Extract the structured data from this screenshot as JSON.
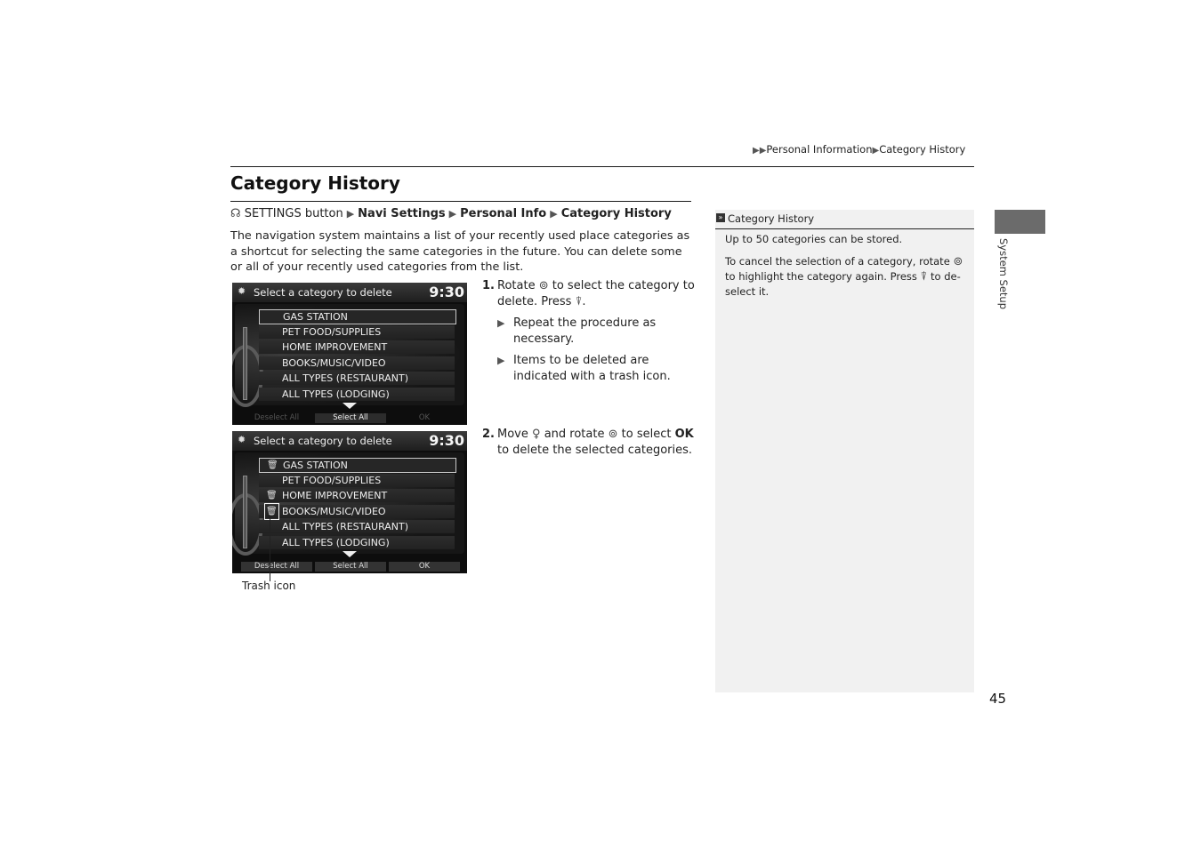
{
  "running_header": {
    "prefix_icon": "double-triangle-icon",
    "section": "Personal Information",
    "separator_icon": "triangle-icon",
    "current": "Category History"
  },
  "title": "Category History",
  "menu_path": {
    "icon": "settings-button-icon",
    "start": "SETTINGS button",
    "items": [
      "Navi Settings",
      "Personal Info",
      "Category History"
    ]
  },
  "intro": "The navigation system maintains a list of your recently used place categories as a shortcut for selecting the same categories in the future. You can delete some or all of your recently used categories from the list.",
  "screens": [
    {
      "title": "Select a category to delete",
      "clock": "9:30",
      "rows": [
        {
          "label": "GAS STATION",
          "selected": true,
          "trash": false
        },
        {
          "label": "PET FOOD/SUPPLIES",
          "selected": false,
          "trash": false
        },
        {
          "label": "HOME IMPROVEMENT",
          "selected": false,
          "trash": false
        },
        {
          "label": "BOOKS/MUSIC/VIDEO",
          "selected": false,
          "trash": false
        },
        {
          "label": "ALL TYPES (RESTAURANT)",
          "selected": false,
          "trash": false
        },
        {
          "label": "ALL TYPES (LODGING)",
          "selected": false,
          "trash": false
        }
      ],
      "footer": [
        "Deselect All",
        "Select All",
        "OK"
      ]
    },
    {
      "title": "Select a category to delete",
      "clock": "9:30",
      "rows": [
        {
          "label": "GAS STATION",
          "selected": true,
          "trash": true
        },
        {
          "label": "PET FOOD/SUPPLIES",
          "selected": false,
          "trash": false
        },
        {
          "label": "HOME IMPROVEMENT",
          "selected": false,
          "trash": true
        },
        {
          "label": "BOOKS/MUSIC/VIDEO",
          "selected": false,
          "trash": true
        },
        {
          "label": "ALL TYPES (RESTAURANT)",
          "selected": false,
          "trash": false
        },
        {
          "label": "ALL TYPES (LODGING)",
          "selected": false,
          "trash": false
        }
      ],
      "footer": [
        "Deselect All",
        "Select All",
        "OK"
      ]
    }
  ],
  "callout": "Trash icon",
  "steps": [
    {
      "num": "1.",
      "text_a": "Rotate",
      "icon_a": "interface-dial-rotate-icon",
      "text_b": "to select the category to delete. Press",
      "icon_b": "interface-dial-press-icon",
      "text_c": ".",
      "subs": [
        "Repeat the procedure as necessary.",
        "Items to be deleted are indicated with a trash icon."
      ]
    },
    {
      "num": "2.",
      "text_a": "Move",
      "icon_a": "interface-dial-move-icon",
      "text_b": "and rotate",
      "icon_b": "interface-dial-rotate-icon",
      "text_c": "to select",
      "bold": "OK",
      "text_d": "to delete the selected categories."
    }
  ],
  "note": {
    "title": "Category History",
    "p1": "Up to 50 categories can be stored.",
    "p2_a": "To cancel the selection of a category, rotate",
    "p2_b": "to highlight the category again. Press",
    "p2_c": "to de-select it."
  },
  "side_tab": "System Setup",
  "page_number": "45",
  "glyphs": {
    "triangle": "▶",
    "double": "▶▶",
    "rotate": "⊚",
    "press": "⍒",
    "move": "♀",
    "gear": "✹",
    "trash": "🗑",
    "note": "»",
    "settings": "☊"
  }
}
